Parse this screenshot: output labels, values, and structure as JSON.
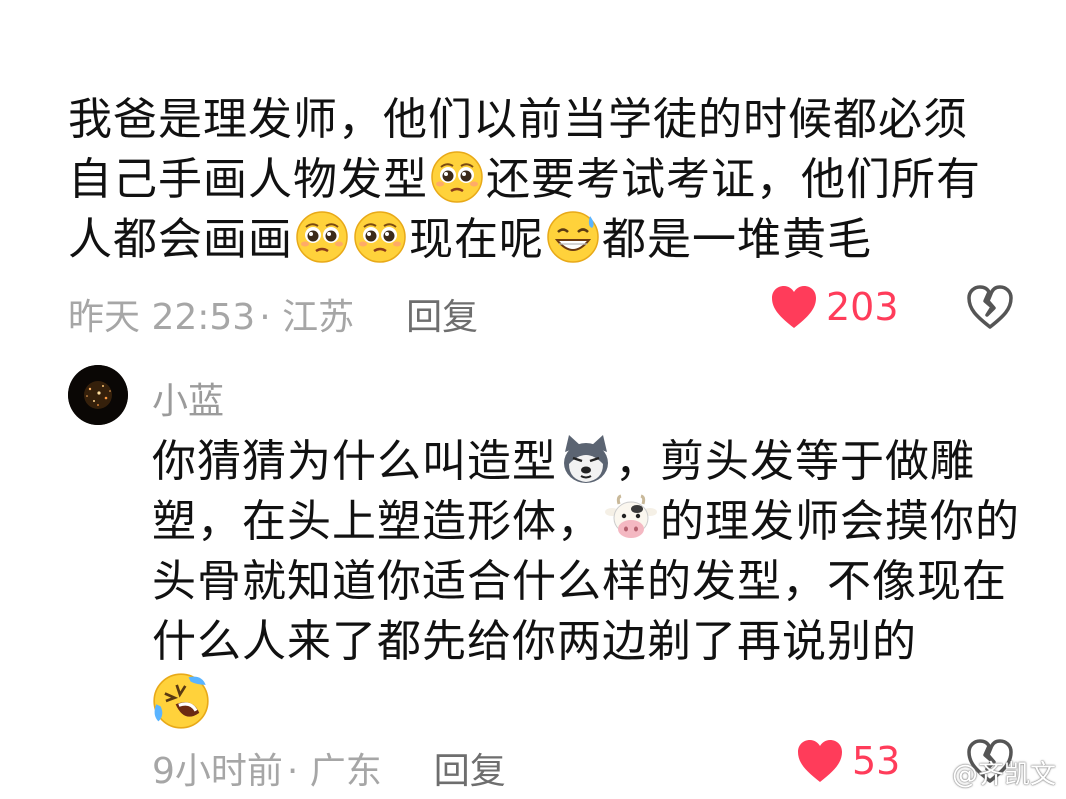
{
  "comment": {
    "segments": [
      "我爸是理发师，他们以前当学徒的时候都必须自己手画人物发型",
      "还要考试考证，他们所有人都会画画",
      "现在呢",
      "都是一堆黄毛"
    ],
    "emojis": [
      "pleading-face",
      "pleading-face",
      "pleading-face",
      "grinning-sweat-face"
    ],
    "time": "昨天 22:53",
    "location": "· 江苏",
    "reply_label": "回复",
    "likes": "203"
  },
  "reply": {
    "username": "小蓝",
    "segments": [
      "你猜猜为什么叫造型",
      "，剪头发等于做雕塑，在头上塑造形体，",
      "的理发师会摸你的头骨就知道你适合什么样的发型，不像现在什么人来了都先给你两边剃了再说别的"
    ],
    "emojis": [
      "husky-dog-face",
      "cow-face",
      "rolling-laughing-face"
    ],
    "time": "9小时前",
    "location": "· 广东",
    "reply_label": "回复",
    "likes": "53"
  },
  "watermark": {
    "text": "@齐凯文"
  },
  "colors": {
    "like": "#ff3c5a",
    "meta": "#a6a6a6",
    "text": "#111111"
  }
}
